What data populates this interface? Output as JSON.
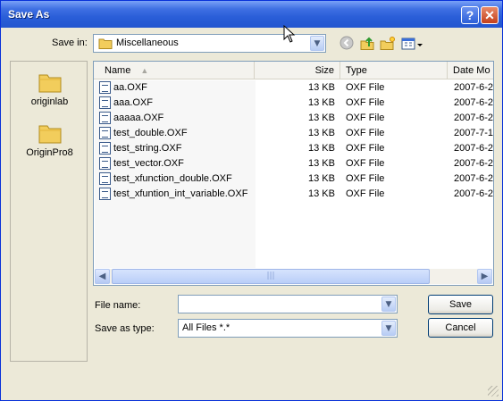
{
  "window": {
    "title": "Save As",
    "help_label": "?",
    "close_label": "✕"
  },
  "savein": {
    "label": "Save in:",
    "value": "Miscellaneous"
  },
  "places": [
    {
      "label": "originlab"
    },
    {
      "label": "OriginPro8"
    }
  ],
  "columns": {
    "name": "Name",
    "size": "Size",
    "type": "Type",
    "date": "Date Mo"
  },
  "files": [
    {
      "name": "aa.OXF",
      "size": "13 KB",
      "type": "OXF File",
      "date": "2007-6-2"
    },
    {
      "name": "aaa.OXF",
      "size": "13 KB",
      "type": "OXF File",
      "date": "2007-6-2"
    },
    {
      "name": "aaaaa.OXF",
      "size": "13 KB",
      "type": "OXF File",
      "date": "2007-6-2"
    },
    {
      "name": "test_double.OXF",
      "size": "13 KB",
      "type": "OXF File",
      "date": "2007-7-1"
    },
    {
      "name": "test_string.OXF",
      "size": "13 KB",
      "type": "OXF File",
      "date": "2007-6-2"
    },
    {
      "name": "test_vector.OXF",
      "size": "13 KB",
      "type": "OXF File",
      "date": "2007-6-2"
    },
    {
      "name": "test_xfunction_double.OXF",
      "size": "13 KB",
      "type": "OXF File",
      "date": "2007-6-2"
    },
    {
      "name": "test_xfuntion_int_variable.OXF",
      "size": "13 KB",
      "type": "OXF File",
      "date": "2007-6-2"
    }
  ],
  "filename": {
    "label": "File name:",
    "value": ""
  },
  "savetype": {
    "label": "Save as type:",
    "value": "All Files *.*"
  },
  "buttons": {
    "save": "Save",
    "cancel": "Cancel"
  },
  "colors": {
    "titlebar": "#2356cf",
    "folder": "#f2cd5c",
    "accent": "#003c74"
  }
}
